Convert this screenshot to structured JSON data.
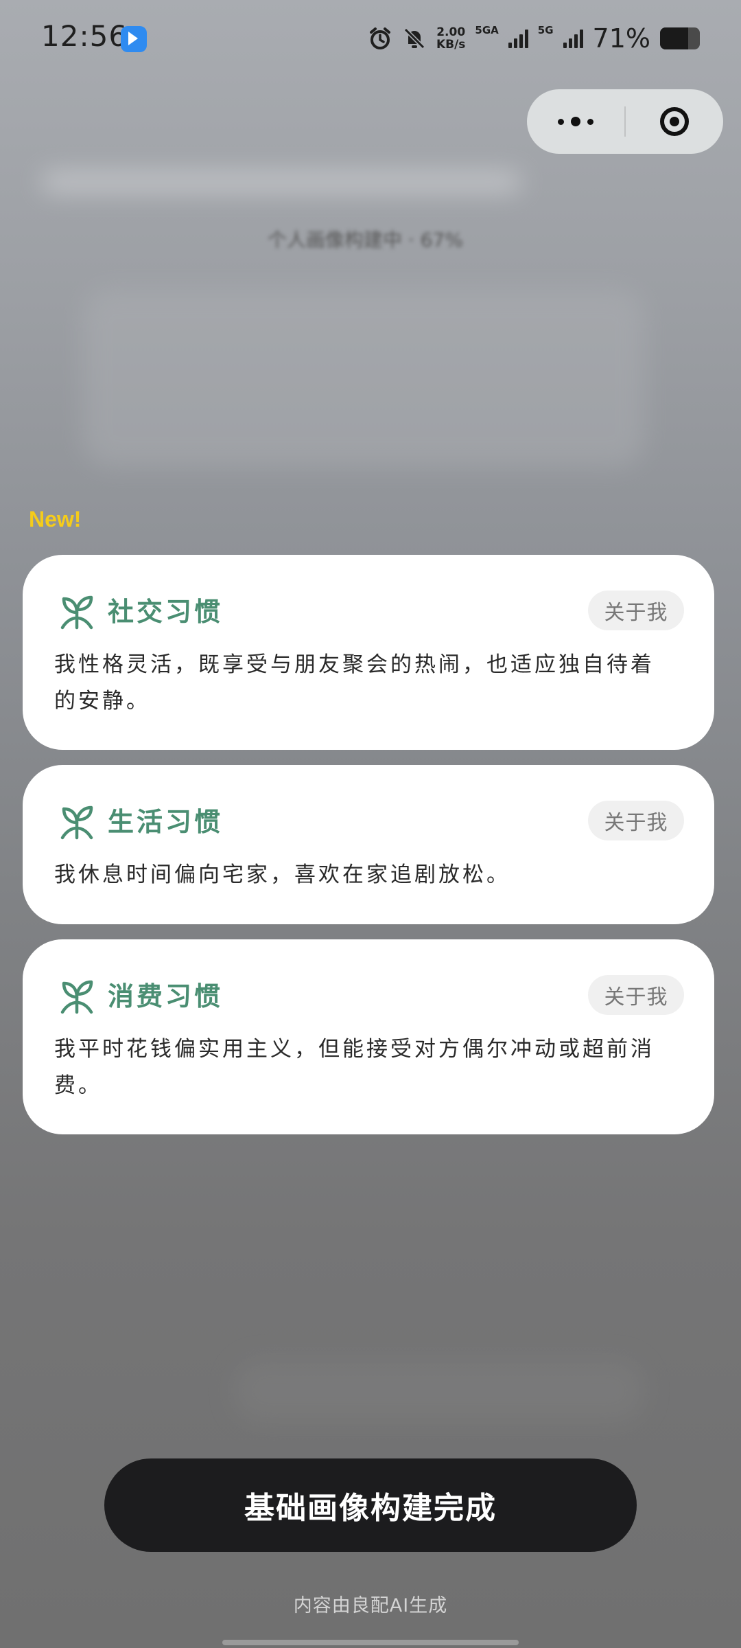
{
  "status_bar": {
    "time": "12:56",
    "net_speed_value": "2.00",
    "net_speed_unit": "KB/s",
    "sim1_label": "5GA",
    "sim2_label": "5G",
    "battery_percent_text": "71%",
    "battery_level": 0.71
  },
  "background": {
    "blurred_text": "个人画像构建中 · 67%"
  },
  "new_tag": "New!",
  "cards": [
    {
      "title": "社交习惯",
      "pill": "关于我",
      "desc": "我性格灵活，既享受与朋友聚会的热闹，也适应独自待着的安静。"
    },
    {
      "title": "生活习惯",
      "pill": "关于我",
      "desc": "我休息时间偏向宅家，喜欢在家追剧放松。"
    },
    {
      "title": "消费习惯",
      "pill": "关于我",
      "desc": "我平时花钱偏实用主义，但能接受对方偶尔冲动或超前消费。"
    }
  ],
  "primary_button": "基础画像构建完成",
  "footer_note": "内容由良配AI生成",
  "colors": {
    "accent_green": "#4a8e72",
    "new_yellow": "#f5cc1a",
    "button_dark": "#1c1c1e"
  },
  "icons": {
    "card_icon": "sprout-icon",
    "capsule_more": "more-dots-icon",
    "capsule_close": "target-close-icon"
  }
}
